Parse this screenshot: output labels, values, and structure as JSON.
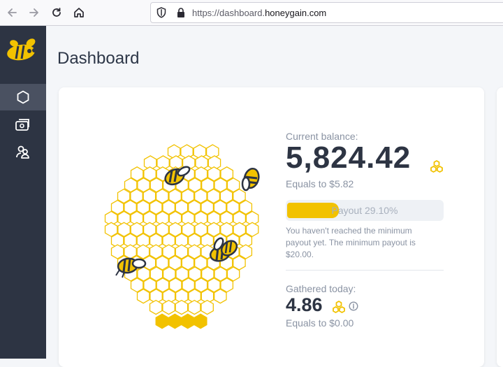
{
  "browser": {
    "url_prefix": "https://dashboard.",
    "url_domain": "honeygain.com",
    "icons": [
      "back-arrow-icon",
      "forward-arrow-icon",
      "reload-icon",
      "home-icon",
      "shield-icon",
      "lock-icon"
    ]
  },
  "sidebar": {
    "items": [
      {
        "name": "dashboard",
        "icon": "hexagon-icon",
        "active": true
      },
      {
        "name": "payouts",
        "icon": "wallet-icon",
        "active": false
      },
      {
        "name": "referrals",
        "icon": "users-icon",
        "active": false
      }
    ]
  },
  "page": {
    "title": "Dashboard"
  },
  "balance": {
    "label": "Current balance:",
    "value": "5,824.42",
    "equals": "Equals to $5.82",
    "payout_text": "Payout 29.10%",
    "payout_progress": 0.291,
    "notice": "You haven't reached the minimum payout yet. The minimum payout is $20.00."
  },
  "gathered": {
    "label": "Gathered today:",
    "value": "4.86",
    "equals": "Equals to $0.00"
  },
  "colors": {
    "sidebar": "#2d3443",
    "accent": "#f2c200",
    "text_dark": "#2d3443",
    "text_muted": "#8a93a3"
  }
}
